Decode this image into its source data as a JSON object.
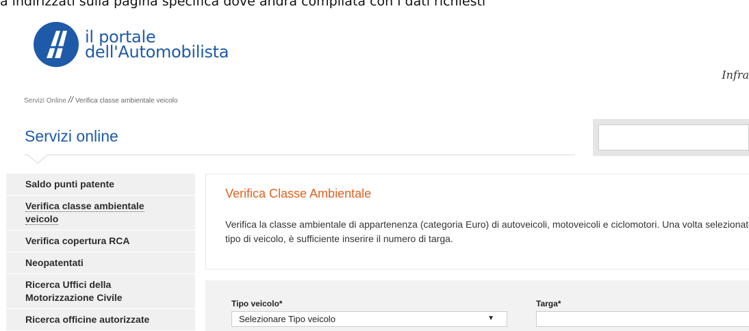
{
  "top_caption": "a indirizzati sulla pagina specifica dove andrà compilata con i dati richiesti",
  "header": {
    "logo_line1": "il portale",
    "logo_line2": "dell'Automobilista",
    "tagline": "Infra"
  },
  "breadcrumb": {
    "home": "Servizi Online",
    "separator": "//",
    "current": "Verifica classe ambientale veicolo"
  },
  "section_title": "Servizi online",
  "search": {
    "placeholder": ""
  },
  "sidebar": {
    "items": [
      {
        "label": "Saldo punti patente"
      },
      {
        "label": "Verifica classe ambientale veicolo"
      },
      {
        "label": "Verifica copertura RCA"
      },
      {
        "label": "Neopatentati"
      },
      {
        "label": "Ricerca Uffici della Motorizzazione Civile"
      },
      {
        "label": "Ricerca officine autorizzate"
      }
    ]
  },
  "content": {
    "title": "Verifica Classe Ambientale",
    "description": "Verifica la classe ambientale di appartenenza (categoria Euro) di autoveicoli, motoveicoli e ciclomotori. Una volta selezionato il tipo di veicolo, è sufficiente inserire il numero di targa."
  },
  "form": {
    "tipo_label": "Tipo veicolo*",
    "tipo_value": "Selezionare Tipo veicolo",
    "targa_label": "Targa*",
    "targa_value": ""
  },
  "colors": {
    "brand_blue": "#1e5aa8",
    "accent_orange": "#e06220"
  }
}
